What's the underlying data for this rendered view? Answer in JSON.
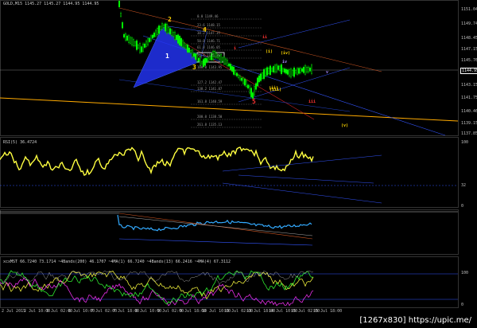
{
  "panels": {
    "main": {
      "header": "GOLD,M15  1145.27 1145.27 1144.95 1144.95",
      "price_tag": "1144.95",
      "axis": [
        "1151.04",
        "1149.74",
        "1148.45",
        "1147.15",
        "1145.76",
        "1144.44",
        "1143.15",
        "1141.75",
        "1140.46",
        "1139.15",
        "1137.85"
      ],
      "fib_levels": [
        "0.0   1149.46",
        "23.6  1148.15",
        "38.2  1147.35",
        "50.0  1146.71",
        "61.8  1146.05",
        "76.4  1145.26",
        "100.0 1143.95",
        "127.2 1142.47",
        "138.2 1141.87",
        "161.8 1140.59",
        "200.0 1138.50",
        "261.8 1135.13"
      ],
      "wave_labels": [
        "1",
        "2",
        "3",
        "4",
        "5",
        "(i)",
        "(ii)",
        "(iii)",
        "(iv)",
        "(v)",
        "i",
        "ii",
        "iii",
        "iv",
        "v"
      ]
    },
    "rsi": {
      "header": "RSI(5) 36.4724",
      "axis": [
        "100",
        "32",
        "0"
      ]
    },
    "macd": {
      "header": ""
    },
    "stoch": {
      "header": "xcxMST 66.7240 73.1714   ~4Bands(200) 46.1707   ~4MA(1) 66.7240   ~4Bands(13) 66.2416   ~4MA(4) 67.3112",
      "axis": [
        "100",
        "0"
      ]
    }
  },
  "time_axis": [
    "2 Jul 2015",
    "2 Jul 10:00",
    "3 Jul 02:00",
    "6 Jul 10:00",
    "7 Jul 02:00",
    "7 Jul 18:00",
    "8 Jul 10:00",
    "9 Jul 02:00",
    "9 Jul 18:00",
    "10 Jul 10:00",
    "13 Jul 02:00",
    "13 Jul 18:00",
    "14 Jul 10:00",
    "15 Jul 02:00",
    "15 Jul 18:00"
  ],
  "watermark": "[1267x830] https://upic.me/",
  "colors": {
    "bull": "#00ff00",
    "bear": "#00cc00",
    "rsi": "#ffff40",
    "blue": "#3355ff",
    "orange": "#ffaa00",
    "red": "#cc2222"
  }
}
